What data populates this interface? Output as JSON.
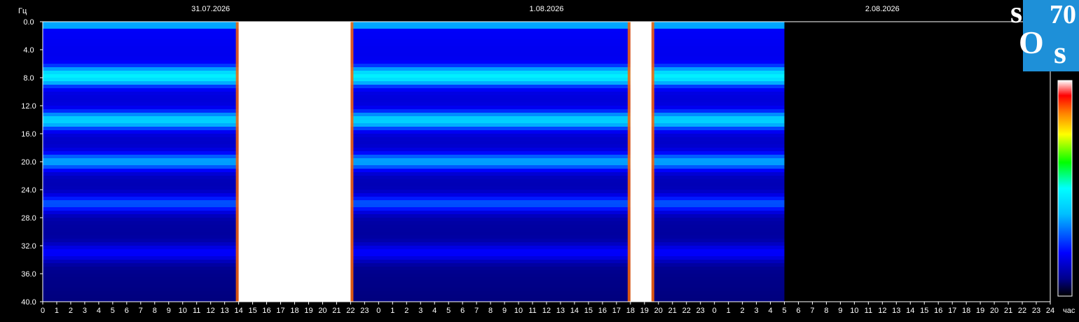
{
  "chart_data": {
    "type": "heatmap",
    "ylabel": "Гц",
    "xlabel": "час",
    "ylim": [
      0,
      40
    ],
    "y_ticks": [
      "0.0",
      "4.0",
      "8.0",
      "12.0",
      "16.0",
      "20.0",
      "24.0",
      "28.0",
      "32.0",
      "36.0",
      "40.0"
    ],
    "dates": [
      "31.07.2026",
      "1.08.2026",
      "2.08.2026"
    ],
    "x_ticks": [
      "0",
      "1",
      "2",
      "3",
      "4",
      "5",
      "6",
      "7",
      "8",
      "9",
      "10",
      "11",
      "12",
      "13",
      "14",
      "15",
      "16",
      "17",
      "18",
      "19",
      "20",
      "21",
      "22",
      "23",
      "0",
      "1",
      "2",
      "3",
      "4",
      "5",
      "6",
      "7",
      "8",
      "9",
      "10",
      "11",
      "12",
      "13",
      "14",
      "15",
      "16",
      "17",
      "18",
      "19",
      "20",
      "21",
      "22",
      "23",
      "0",
      "1",
      "2",
      "3",
      "4",
      "5",
      "6",
      "7",
      "8",
      "9",
      "10",
      "11",
      "12",
      "13",
      "14",
      "15",
      "16",
      "17",
      "18",
      "19",
      "20",
      "21",
      "22",
      "23",
      "24"
    ],
    "x_range_hours": [
      0,
      72
    ],
    "data_end_hour": 53,
    "resonance_bands_hz": [
      7.8,
      14.1,
      20.0,
      26.0,
      33.0
    ],
    "saturated_intervals_hours": [
      [
        14.0,
        22.0
      ],
      [
        42.0,
        43.5
      ]
    ],
    "colorscale": [
      "#000000",
      "#00008b",
      "#0000ff",
      "#00bfff",
      "#00ffff",
      "#00ff00",
      "#ffff00",
      "#ff8000",
      "#ff0000",
      "#ffffff"
    ]
  },
  "logo": {
    "line1a": "s",
    "line1b": "70",
    "line2a": "O",
    "line2b": "s",
    "bg_color": "#1e90d8"
  }
}
